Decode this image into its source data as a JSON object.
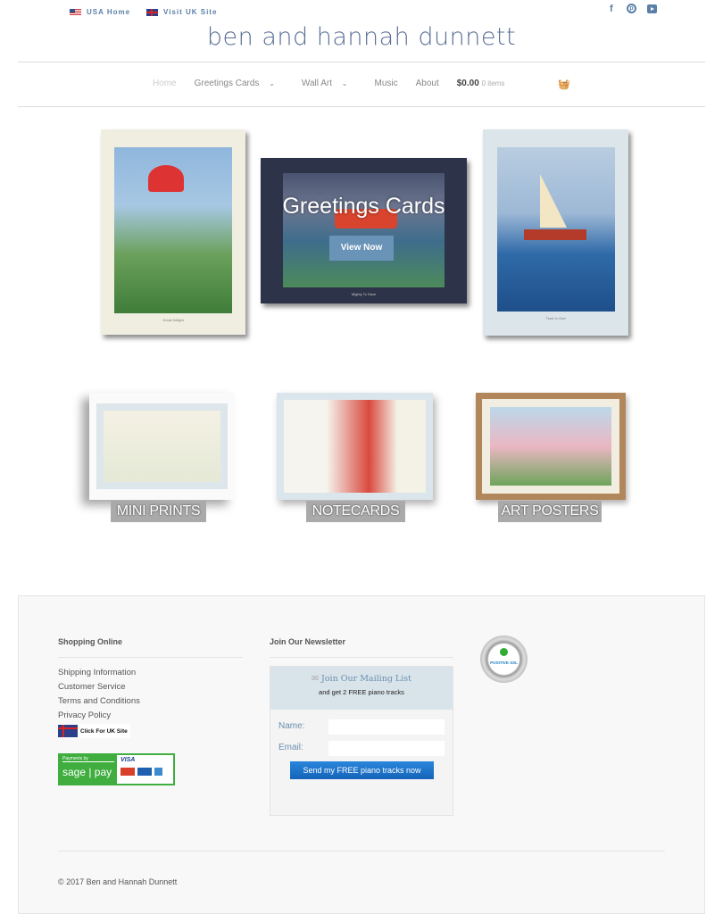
{
  "topbar": {
    "usa_home": "USA Home",
    "visit_uk": "Visit UK Site",
    "social": [
      "facebook-icon",
      "pinterest-icon",
      "youtube-icon"
    ]
  },
  "logo": "ben and hannah dunnett",
  "nav": {
    "items": [
      "Home",
      "Greetings Cards",
      "Wall Art",
      "Music",
      "About"
    ],
    "cart_total": "$0.00",
    "cart_items": "0 items"
  },
  "hero": {
    "left_caption": "Great Delight",
    "center_title": "Greetings Cards",
    "center_button": "View Now",
    "center_caption": "Mighty To Save",
    "right_caption": "Trust In God"
  },
  "categories": [
    "MINI PRINTS",
    "NOTECARDS",
    "ART POSTERS"
  ],
  "footer": {
    "shopping_heading": "Shopping Online",
    "links": [
      "Shipping Information",
      "Customer Service",
      "Terms and Conditions",
      "Privacy Policy"
    ],
    "uk_link": "Click For UK Site",
    "payments_by": "Payments by",
    "sagepay": "sage | pay",
    "visa": "VISA",
    "newsletter_heading": "Join Our Newsletter",
    "mailing_title": "Join Our Mailing List",
    "mailing_sub": "and get 2 FREE piano tracks",
    "name_label": "Name:",
    "email_label": "Email:",
    "name_value": "",
    "email_value": "",
    "submit": "Send my FREE piano tracks now",
    "ssl": "POSITIVE SSL",
    "copyright": "© 2017 Ben and Hannah Dunnett"
  },
  "colors": {
    "accent": "#5a7fa8",
    "button": "#1a72c9",
    "footer_bg": "#f8f8f8"
  }
}
